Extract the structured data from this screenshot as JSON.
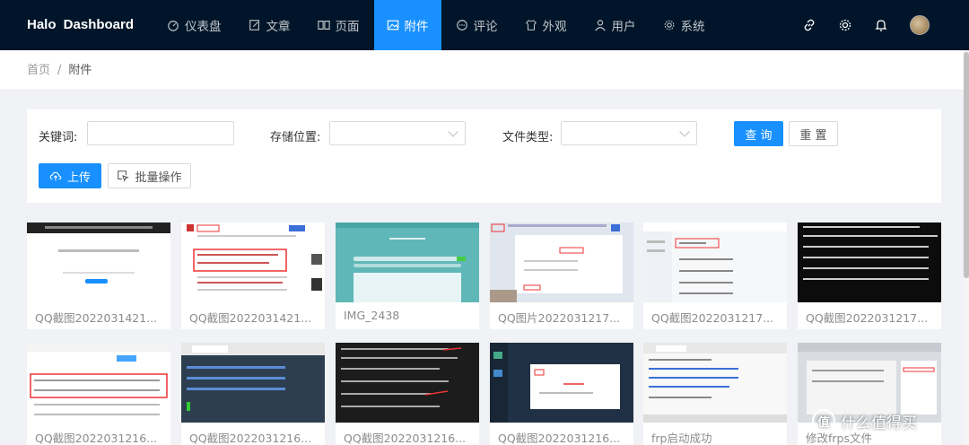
{
  "header": {
    "logo": "Halo  Dashboard",
    "nav": [
      {
        "label": "仪表盘",
        "icon": "dashboard-icon"
      },
      {
        "label": "文章",
        "icon": "edit-icon"
      },
      {
        "label": "页面",
        "icon": "book-icon"
      },
      {
        "label": "附件",
        "icon": "picture-icon",
        "active": true
      },
      {
        "label": "评论",
        "icon": "comment-icon"
      },
      {
        "label": "外观",
        "icon": "skin-icon"
      },
      {
        "label": "用户",
        "icon": "user-icon"
      },
      {
        "label": "系统",
        "icon": "setting-icon"
      }
    ],
    "accent": "#1890ff",
    "bg": "#001529"
  },
  "breadcrumb": {
    "home": "首页",
    "sep": "/",
    "current": "附件"
  },
  "filters": {
    "keyword_label": "关键词:",
    "storage_label": "存储位置:",
    "type_label": "文件类型:",
    "keyword_value": "",
    "storage_value": "",
    "type_value": "",
    "query_button": "查 询",
    "reset_button": "重 置",
    "upload_button": "上传",
    "batch_button": "批量操作"
  },
  "attachments": [
    {
      "name": "QQ截图2022031421..."
    },
    {
      "name": "QQ截图2022031421..."
    },
    {
      "name": "IMG_2438"
    },
    {
      "name": "QQ图片2022031217..."
    },
    {
      "name": "QQ截图2022031217..."
    },
    {
      "name": "QQ截图2022031217..."
    },
    {
      "name": "QQ截图2022031216..."
    },
    {
      "name": "QQ截图2022031216..."
    },
    {
      "name": "QQ截图2022031216..."
    },
    {
      "name": "QQ截图2022031216..."
    },
    {
      "name": "frp启动成功"
    },
    {
      "name": "修改frps文件"
    }
  ],
  "watermark": {
    "mark": "值",
    "text": "什么值得买"
  }
}
